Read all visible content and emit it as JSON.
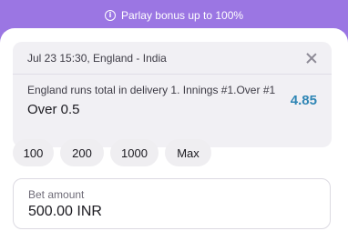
{
  "banner": {
    "text": "Parlay bonus up to 100%",
    "icon": "info-icon"
  },
  "bet": {
    "match": "Jul 23 15:30, England - India",
    "market": "England runs total in delivery 1. Innings #1.Over #1",
    "outcome": "Over 0.5",
    "odds": "4.85"
  },
  "quick_amounts": [
    "100",
    "200",
    "1000",
    "Max"
  ],
  "stake": {
    "label": "Bet amount",
    "value": "500.00 INR"
  },
  "colors": {
    "banner_bg": "#9b76e3",
    "odds": "#2f86b5",
    "card_bg": "#f1f0f4"
  }
}
